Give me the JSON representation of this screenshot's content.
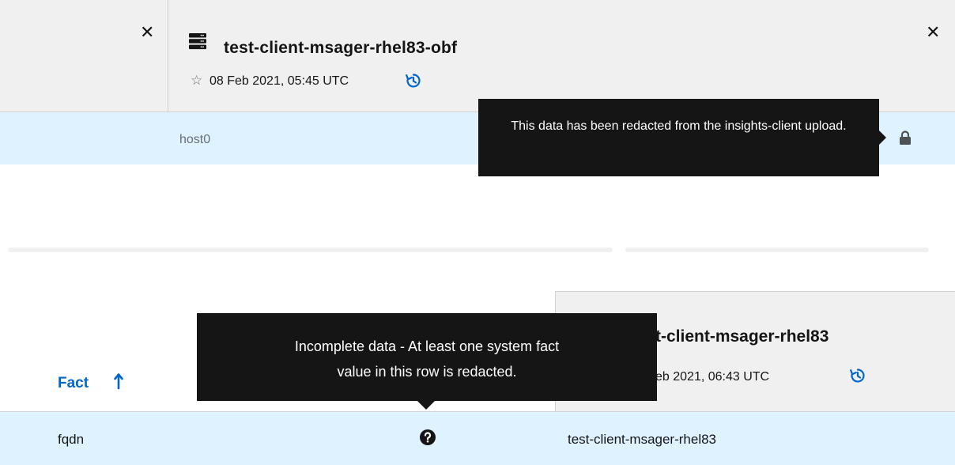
{
  "top_panel": {
    "left_close_label": "✕",
    "right_close_label": "✕",
    "system_name": "test-client-msager-rhel83-obf",
    "system_date": "08 Feb 2021, 05:45 UTC",
    "host_row_value": "host0",
    "redacted_tooltip": "This data has been redacted from the insights-client upload."
  },
  "bottom_panel": {
    "system_name": "t-client-msager-rhel83",
    "system_date": "eb 2021, 06:43 UTC",
    "fact_column_header": "Fact",
    "row": {
      "fact": "fqdn",
      "value": "test-client-msager-rhel83"
    },
    "incomplete_tooltip_line1": "Incomplete data - At least one system fact",
    "incomplete_tooltip_line2": "value in this row is redacted."
  },
  "colors": {
    "header_bg": "#f0f0f0",
    "row_highlight": "#def3ff",
    "link_blue": "#0066cc",
    "tooltip_bg": "#151515"
  },
  "icons": {
    "server": "server-icon",
    "star": "star-outline-icon",
    "history": "history-icon",
    "lock": "lock-icon",
    "question": "question-circle-icon",
    "sort": "sort-arrow-up-icon"
  }
}
